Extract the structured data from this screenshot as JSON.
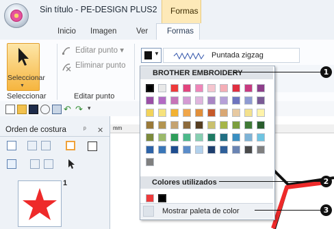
{
  "window": {
    "title": "Sin título - PE-DESIGN PLUS2",
    "context_tab": "Formas"
  },
  "tabs": [
    "Inicio",
    "Imagen",
    "Ver",
    "Formas"
  ],
  "ribbon": {
    "select_label": "Seleccionar",
    "group_select": "Seleccionar",
    "edit_point": "Editar punto",
    "delete_point": "Eliminar punto",
    "group_edit_point": "Editar punto",
    "stitch_type": "Puntada zigzag"
  },
  "pane": {
    "title": "Orden de costura",
    "pin": "ᵖ",
    "close": "✕",
    "thumb_number": "1"
  },
  "ruler": {
    "unit": "mm"
  },
  "dropdown": {
    "palette_header": "BROTHER EMBROIDERY",
    "used_header": "Colores utilizados",
    "footer": "Mostrar paleta de color",
    "palette": [
      [
        "#000000",
        "#e8e8e8",
        "#ee3a3a",
        "#e2457d",
        "#ef86b8",
        "#f5c6cf",
        "#f4aeb6",
        "#e02f40",
        "#c83a80",
        "#8e3f8a"
      ],
      [
        "#9b4fa6",
        "#b36ac4",
        "#c774b8",
        "#d59bd3",
        "#e0b6de",
        "#a986c4",
        "#b6a0d8",
        "#6e74bf",
        "#8f9bd2",
        "#7a5b95"
      ],
      [
        "#f2d35a",
        "#f6e27c",
        "#f2b233",
        "#f0a64a",
        "#e18f3a",
        "#c65a2a",
        "#d9a774",
        "#e7c9a1",
        "#f3e18d",
        "#fff3a9"
      ],
      [
        "#9a7a39",
        "#b39551",
        "#c4a270",
        "#8c6a3c",
        "#563e22",
        "#c9c06e",
        "#a5b548",
        "#7c9e3e",
        "#3f7a36",
        "#2a5d2d"
      ],
      [
        "#7c8a3b",
        "#9bba6b",
        "#2f9e5a",
        "#4db98a",
        "#87cfb1",
        "#1e7a63",
        "#216f83",
        "#3a8fc1",
        "#7eb3d6",
        "#6fc4e1"
      ],
      [
        "#2d63a8",
        "#3a76b8",
        "#1f4d8f",
        "#5b8cc9",
        "#b2d1ec",
        "#1e3f6e",
        "#2e5f99",
        "#6a84b3",
        "#4a4a4a",
        "#808080"
      ],
      [
        "#7f7f7f"
      ]
    ],
    "used_colors": [
      "#ee3a3a",
      "#000000"
    ]
  },
  "callouts": [
    "1",
    "2",
    "3"
  ],
  "colors": {
    "accent_orange": "#f6b53f",
    "context_tab_bg": "#fde9b8",
    "star": "#ee2a2a"
  }
}
